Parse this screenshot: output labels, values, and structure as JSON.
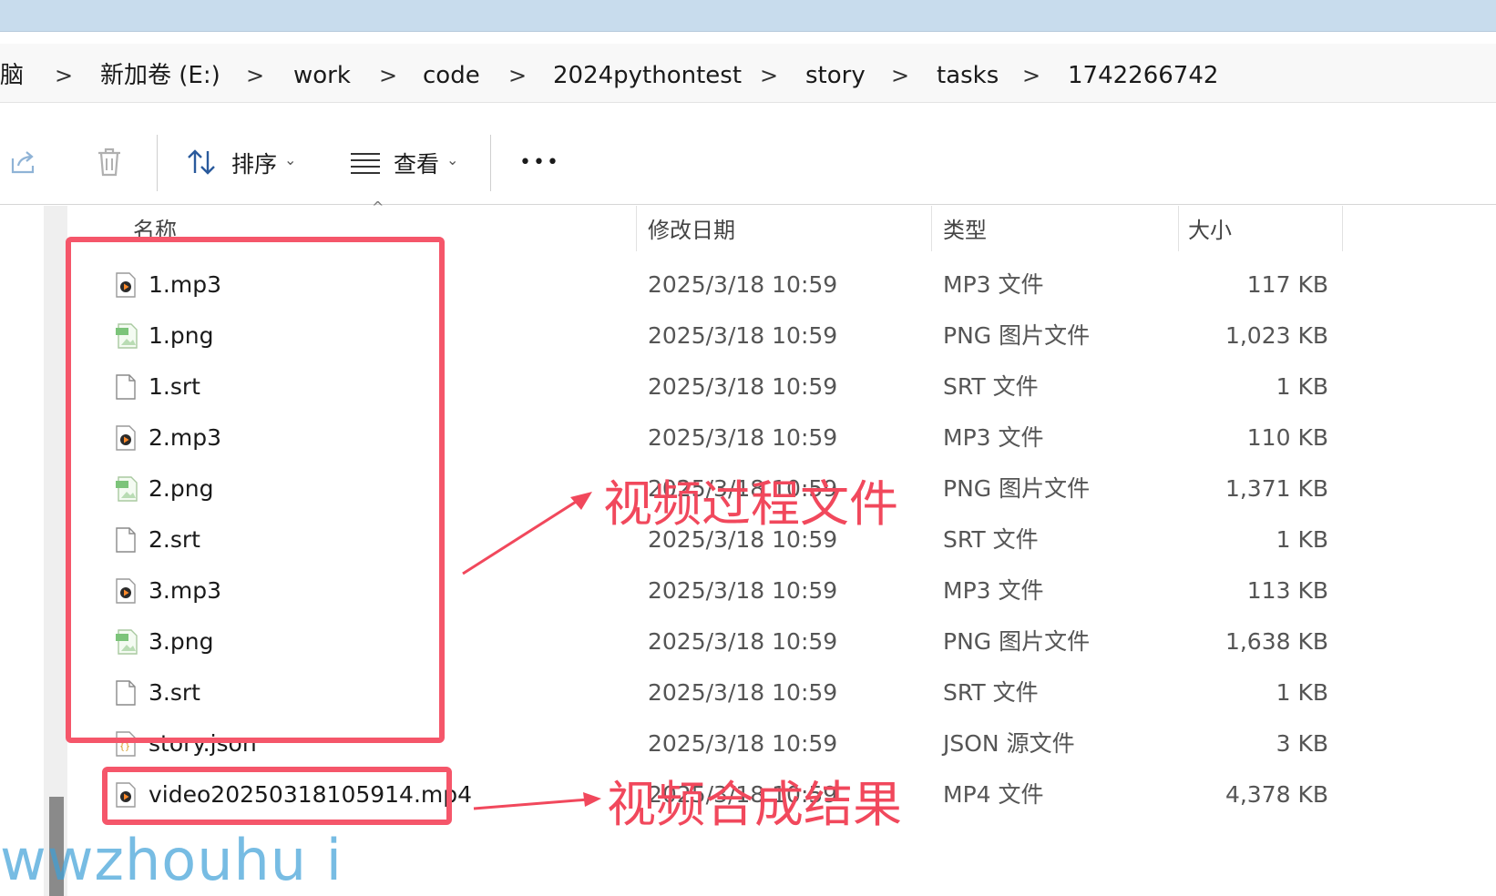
{
  "breadcrumb": {
    "items": [
      "脑",
      "新加卷 (E:)",
      "work",
      "code",
      "2024pythontest",
      "story",
      "tasks",
      "1742266742"
    ],
    "separator": ">"
  },
  "toolbar": {
    "sort_label": "排序",
    "view_label": "查看",
    "more_label": "•••"
  },
  "columns": {
    "name": "名称",
    "date": "修改日期",
    "type": "类型",
    "size": "大小"
  },
  "files": [
    {
      "name": "1.mp3",
      "date": "2025/3/18 10:59",
      "type": "MP3 文件",
      "size": "117 KB",
      "icon": "audio-file-icon"
    },
    {
      "name": "1.png",
      "date": "2025/3/18 10:59",
      "type": "PNG 图片文件",
      "size": "1,023 KB",
      "icon": "image-file-icon"
    },
    {
      "name": "1.srt",
      "date": "2025/3/18 10:59",
      "type": "SRT 文件",
      "size": "1 KB",
      "icon": "blank-file-icon"
    },
    {
      "name": "2.mp3",
      "date": "2025/3/18 10:59",
      "type": "MP3 文件",
      "size": "110 KB",
      "icon": "audio-file-icon"
    },
    {
      "name": "2.png",
      "date": "2025/3/18 10:59",
      "type": "PNG 图片文件",
      "size": "1,371 KB",
      "icon": "image-file-icon"
    },
    {
      "name": "2.srt",
      "date": "2025/3/18 10:59",
      "type": "SRT 文件",
      "size": "1 KB",
      "icon": "blank-file-icon"
    },
    {
      "name": "3.mp3",
      "date": "2025/3/18 10:59",
      "type": "MP3 文件",
      "size": "113 KB",
      "icon": "audio-file-icon"
    },
    {
      "name": "3.png",
      "date": "2025/3/18 10:59",
      "type": "PNG 图片文件",
      "size": "1,638 KB",
      "icon": "image-file-icon"
    },
    {
      "name": "3.srt",
      "date": "2025/3/18 10:59",
      "type": "SRT 文件",
      "size": "1 KB",
      "icon": "blank-file-icon"
    },
    {
      "name": "story.json",
      "date": "2025/3/18 10:59",
      "type": "JSON 源文件",
      "size": "3 KB",
      "icon": "json-file-icon"
    },
    {
      "name": "video20250318105914.mp4",
      "date": "2025/3/18 10:59",
      "type": "MP4 文件",
      "size": "4,378 KB",
      "icon": "video-file-icon"
    }
  ],
  "annotations": {
    "process_files": "视频过程文件",
    "result": "视频合成结果"
  },
  "watermark": "wwzhouhu i",
  "colors": {
    "highlight": "#f5566a",
    "annotation_text": "#f1485c",
    "titlebar": "#c8dced",
    "watermark": "#3ea0d8"
  }
}
